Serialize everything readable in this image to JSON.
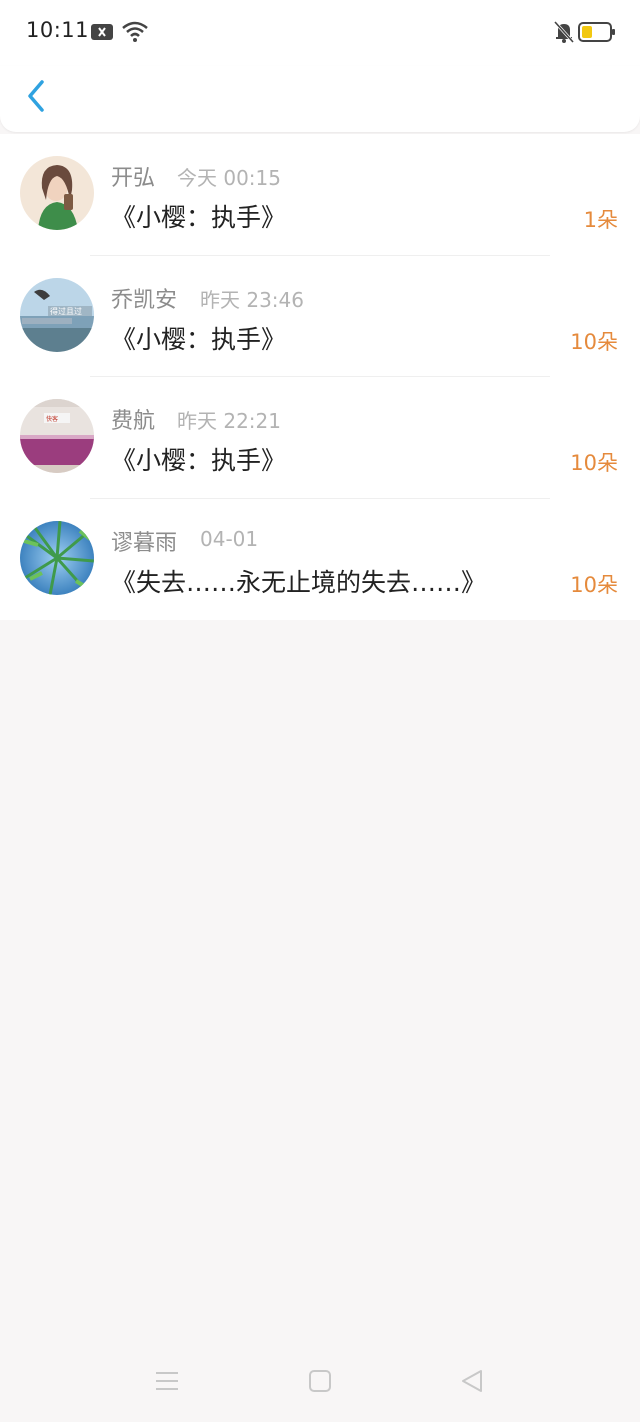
{
  "status_bar": {
    "time": "10:11",
    "icons": [
      "notification-x-icon",
      "wifi-icon",
      "mute-bell-icon",
      "battery-icon"
    ],
    "battery_color": "#f2c811"
  },
  "header": {
    "back_icon": "chevron-left-icon",
    "accent": "#2fa2e0"
  },
  "list": [
    {
      "name": "开弘",
      "time": "今天 00:15",
      "title": "《小樱：执手》",
      "flowers": "1朵",
      "avatar": "avatar-woman-drink"
    },
    {
      "name": "乔凯安",
      "time": "昨天 23:46",
      "title": "《小樱：执手》",
      "flowers": "10朵",
      "avatar": "avatar-seaside-photo"
    },
    {
      "name": "费航",
      "time": "昨天 22:21",
      "title": "《小樱：执手》",
      "flowers": "10朵",
      "avatar": "avatar-shop-interior"
    },
    {
      "name": "谬暮雨",
      "time": "04-01",
      "title": "《失去……永无止境的失去……》",
      "flowers": "10朵",
      "avatar": "avatar-bamboo-sky"
    }
  ],
  "nav": {
    "icons": [
      "menu-icon",
      "home-square-icon",
      "back-triangle-icon"
    ]
  },
  "colors": {
    "flower_count": "#e58a3c",
    "name": "#8c8c8c",
    "time": "#b3b3b3",
    "title": "#222222"
  }
}
